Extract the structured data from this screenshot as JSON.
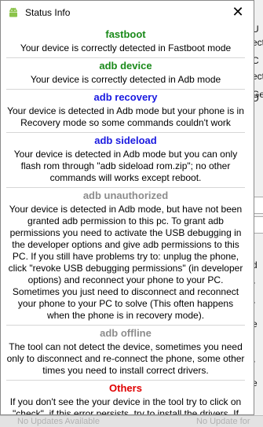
{
  "window": {
    "title": "Status Info",
    "close_glyph": "✕",
    "icon": "android-icon"
  },
  "colors": {
    "fastboot": "#1a8a1a",
    "device": "#1a8a1a",
    "recovery": "#1a1ae0",
    "sideload": "#1a1ae0",
    "unauthorized": "#8c8c8c",
    "offline": "#8c8c8c",
    "others": "#e00000"
  },
  "sections": [
    {
      "key": "fastboot",
      "title": "fastboot",
      "body": "Your device is correctly detected in Fastboot mode"
    },
    {
      "key": "device",
      "title": "adb device",
      "body": "Your device is correctly detected in Adb mode"
    },
    {
      "key": "recovery",
      "title": "adb recovery",
      "body": "Your device is detected in Adb mode but your phone is in Recovery mode so some commands couldn't work"
    },
    {
      "key": "sideload",
      "title": "adb sideload",
      "body": "Your device is detected in Adb mode but you  can only flash rom through \"adb sideload rom.zip\"; no other commands will works except reboot."
    },
    {
      "key": "unauthorized",
      "title": "adb unauthorized",
      "body": "Your device is detected in Adb mode, but have not been granted adb permission to this pc. To grant adb permissions you need to activate the USB debugging in the developer options and give adb permissions to this PC. If you still have problems try to: unplug the phone, click \"revoke USB debugging permissions\" (in developer options) and reconnect your phone to your PC. Sometimes you just need to disconnect and reconnect your phone to your PC to solve (This often happens when the phone is in recovery mode)."
    },
    {
      "key": "offline",
      "title": "adb offline",
      "body": "The tool can not detect the device, sometimes you need only to disconnect and re-connect the phone, some other times you need to install correct drivers."
    },
    {
      "key": "others",
      "title": "Others",
      "body": "If you don't see the your device in the tool try to click on \"check\", if this error persists, try to install the drivers. If still should not be detected any device, try to force the"
    }
  ],
  "background": {
    "fragments": [
      "U",
      "ect",
      "C",
      "ect",
      "D",
      "Ge",
      "d",
      "r",
      "r",
      "e",
      "r",
      "e"
    ],
    "bottom_left": "No Updates Available",
    "bottom_right": "No Update for"
  }
}
